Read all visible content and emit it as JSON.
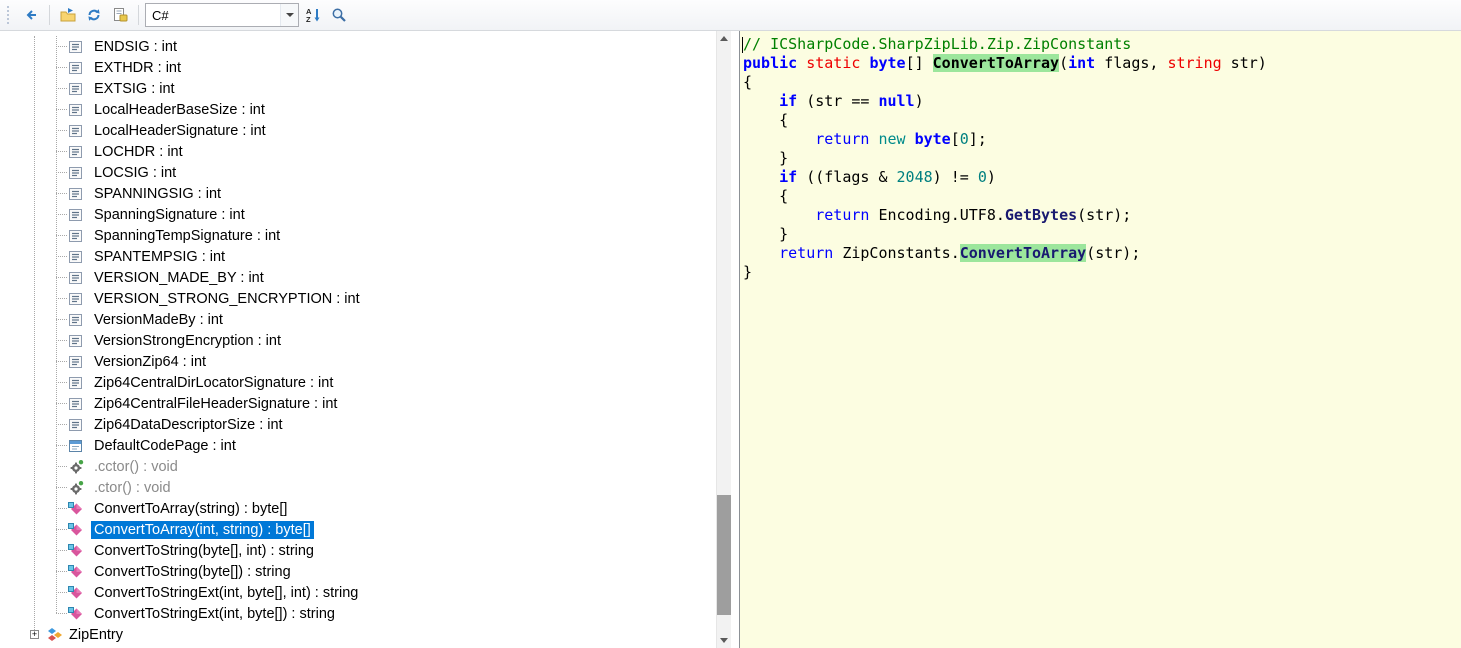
{
  "toolbar": {
    "language": "C#",
    "icons": [
      "back-icon",
      "open-file-icon",
      "refresh-icon",
      "assembly-list-icon",
      "sort-icon",
      "search-icon"
    ]
  },
  "colors": {
    "selection_blue": "#0078D7",
    "symbol_highlight_green": "#9CE69C",
    "code_background": "#FCFDE1",
    "comment_green": "#008000",
    "keyword_blue": "#0000FF",
    "type_red": "#EE0000"
  },
  "tree": {
    "items": [
      {
        "label": "ENDSIG : int",
        "icon": "literal-field-icon",
        "level": 2
      },
      {
        "label": "EXTHDR : int",
        "icon": "literal-field-icon",
        "level": 2
      },
      {
        "label": "EXTSIG : int",
        "icon": "literal-field-icon",
        "level": 2
      },
      {
        "label": "LocalHeaderBaseSize : int",
        "icon": "literal-field-icon",
        "level": 2
      },
      {
        "label": "LocalHeaderSignature : int",
        "icon": "literal-field-icon",
        "level": 2
      },
      {
        "label": "LOCHDR : int",
        "icon": "literal-field-icon",
        "level": 2
      },
      {
        "label": "LOCSIG : int",
        "icon": "literal-field-icon",
        "level": 2
      },
      {
        "label": "SPANNINGSIG : int",
        "icon": "literal-field-icon",
        "level": 2
      },
      {
        "label": "SpanningSignature : int",
        "icon": "literal-field-icon",
        "level": 2
      },
      {
        "label": "SpanningTempSignature : int",
        "icon": "literal-field-icon",
        "level": 2
      },
      {
        "label": "SPANTEMPSIG : int",
        "icon": "literal-field-icon",
        "level": 2
      },
      {
        "label": "VERSION_MADE_BY : int",
        "icon": "literal-field-icon",
        "level": 2
      },
      {
        "label": "VERSION_STRONG_ENCRYPTION : int",
        "icon": "literal-field-icon",
        "level": 2
      },
      {
        "label": "VersionMadeBy : int",
        "icon": "literal-field-icon",
        "level": 2
      },
      {
        "label": "VersionStrongEncryption : int",
        "icon": "literal-field-icon",
        "level": 2
      },
      {
        "label": "VersionZip64 : int",
        "icon": "literal-field-icon",
        "level": 2
      },
      {
        "label": "Zip64CentralDirLocatorSignature : int",
        "icon": "literal-field-icon",
        "level": 2
      },
      {
        "label": "Zip64CentralFileHeaderSignature : int",
        "icon": "literal-field-icon",
        "level": 2
      },
      {
        "label": "Zip64DataDescriptorSize : int",
        "icon": "literal-field-icon",
        "level": 2
      },
      {
        "label": "DefaultCodePage : int",
        "icon": "field-icon",
        "level": 2
      },
      {
        "label": ".cctor() : void",
        "icon": "constructor-icon",
        "level": 2,
        "muted": true
      },
      {
        "label": ".ctor() : void",
        "icon": "constructor-icon",
        "level": 2,
        "muted": true
      },
      {
        "label": "ConvertToArray(string) : byte[]",
        "icon": "method-icon",
        "level": 2
      },
      {
        "label": "ConvertToArray(int, string) : byte[]",
        "icon": "method-icon",
        "level": 2,
        "selected": true
      },
      {
        "label": "ConvertToString(byte[], int) : string",
        "icon": "method-icon",
        "level": 2
      },
      {
        "label": "ConvertToString(byte[]) : string",
        "icon": "method-icon",
        "level": 2
      },
      {
        "label": "ConvertToStringExt(int, byte[], int) : string",
        "icon": "method-icon",
        "level": 2
      },
      {
        "label": "ConvertToStringExt(int, byte[]) : string",
        "icon": "method-icon",
        "level": 2
      },
      {
        "label": "ZipEntry",
        "icon": "class-icon",
        "level": 1,
        "expander": true
      }
    ]
  },
  "code": {
    "lines": [
      [
        {
          "t": "// ICSharpCode.SharpZipLib.Zip.ZipConstants",
          "c": "comment"
        }
      ],
      [
        {
          "t": "public",
          "c": "kwb"
        },
        {
          "t": " ",
          "c": "plain"
        },
        {
          "t": "static",
          "c": "mod"
        },
        {
          "t": " ",
          "c": "plain"
        },
        {
          "t": "byte",
          "c": "kwb"
        },
        {
          "t": "[] ",
          "c": "plain"
        },
        {
          "t": "ConvertToArray",
          "c": "hl"
        },
        {
          "t": "(",
          "c": "plain"
        },
        {
          "t": "int",
          "c": "kwb"
        },
        {
          "t": " flags, ",
          "c": "plain"
        },
        {
          "t": "string",
          "c": "ref"
        },
        {
          "t": " str)",
          "c": "plain"
        }
      ],
      [
        {
          "t": "{",
          "c": "plain"
        }
      ],
      [
        {
          "t": "    ",
          "c": "plain"
        },
        {
          "t": "if",
          "c": "kwb"
        },
        {
          "t": " (str == ",
          "c": "plain"
        },
        {
          "t": "null",
          "c": "kwb"
        },
        {
          "t": ")",
          "c": "plain"
        }
      ],
      [
        {
          "t": "    {",
          "c": "plain"
        }
      ],
      [
        {
          "t": "        ",
          "c": "plain"
        },
        {
          "t": "return",
          "c": "kw"
        },
        {
          "t": " ",
          "c": "plain"
        },
        {
          "t": "new",
          "c": "new"
        },
        {
          "t": " ",
          "c": "plain"
        },
        {
          "t": "byte",
          "c": "kwb"
        },
        {
          "t": "[",
          "c": "plain"
        },
        {
          "t": "0",
          "c": "num"
        },
        {
          "t": "];",
          "c": "plain"
        }
      ],
      [
        {
          "t": "    }",
          "c": "plain"
        }
      ],
      [
        {
          "t": "    ",
          "c": "plain"
        },
        {
          "t": "if",
          "c": "kwb"
        },
        {
          "t": " ((flags & ",
          "c": "plain"
        },
        {
          "t": "2048",
          "c": "num"
        },
        {
          "t": ") != ",
          "c": "plain"
        },
        {
          "t": "0",
          "c": "num"
        },
        {
          "t": ")",
          "c": "plain"
        }
      ],
      [
        {
          "t": "    {",
          "c": "plain"
        }
      ],
      [
        {
          "t": "        ",
          "c": "plain"
        },
        {
          "t": "return",
          "c": "kw"
        },
        {
          "t": " Encoding.UTF8.",
          "c": "plain"
        },
        {
          "t": "GetBytes",
          "c": "call"
        },
        {
          "t": "(str);",
          "c": "plain"
        }
      ],
      [
        {
          "t": "    }",
          "c": "plain"
        }
      ],
      [
        {
          "t": "    ",
          "c": "plain"
        },
        {
          "t": "return",
          "c": "kw"
        },
        {
          "t": " ZipConstants.",
          "c": "plain"
        },
        {
          "t": "ConvertToArray",
          "c": "hlcall"
        },
        {
          "t": "(str);",
          "c": "plain"
        }
      ],
      [
        {
          "t": "}",
          "c": "plain"
        }
      ]
    ]
  }
}
